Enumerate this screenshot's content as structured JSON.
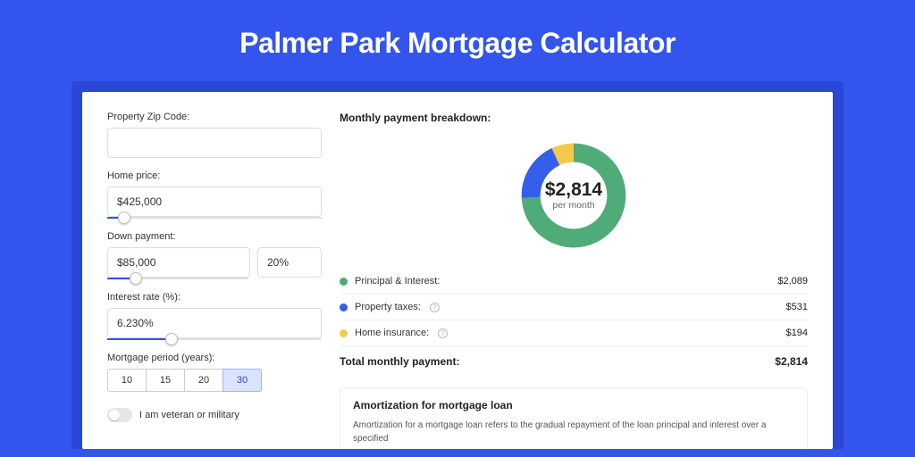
{
  "page": {
    "title": "Palmer Park Mortgage Calculator"
  },
  "form": {
    "zip_label": "Property Zip Code:",
    "zip_value": "",
    "home_price_label": "Home price:",
    "home_price_value": "$425,000",
    "home_price_slider_pct": 8,
    "down_payment_label": "Down payment:",
    "down_payment_value": "$85,000",
    "down_payment_pct_value": "20%",
    "down_payment_slider_pct": 20,
    "rate_label": "Interest rate (%):",
    "rate_value": "6.230%",
    "rate_slider_pct": 30,
    "period_label": "Mortgage period (years):",
    "periods": [
      "10",
      "15",
      "20",
      "30"
    ],
    "period_selected": "30",
    "veteran_label": "I am veteran or military"
  },
  "breakdown": {
    "title": "Monthly payment breakdown:",
    "center_amount": "$2,814",
    "center_sub": "per month",
    "items": [
      {
        "label": "Principal & Interest:",
        "value": "$2,089",
        "color": "#4fab78",
        "help": false
      },
      {
        "label": "Property taxes:",
        "value": "$531",
        "color": "#345eeb",
        "help": true
      },
      {
        "label": "Home insurance:",
        "value": "$194",
        "color": "#f3c94b",
        "help": true
      }
    ],
    "total_label": "Total monthly payment:",
    "total_value": "$2,814"
  },
  "amortization": {
    "title": "Amortization for mortgage loan",
    "body": "Amortization for a mortgage loan refers to the gradual repayment of the loan principal and interest over a specified"
  },
  "chart_data": {
    "type": "pie",
    "title": "Monthly payment breakdown",
    "series": [
      {
        "name": "Principal & Interest",
        "value": 2089,
        "color": "#4fab78"
      },
      {
        "name": "Property taxes",
        "value": 531,
        "color": "#345eeb"
      },
      {
        "name": "Home insurance",
        "value": 194,
        "color": "#f3c94b"
      }
    ],
    "total": 2814,
    "unit": "USD/month"
  }
}
